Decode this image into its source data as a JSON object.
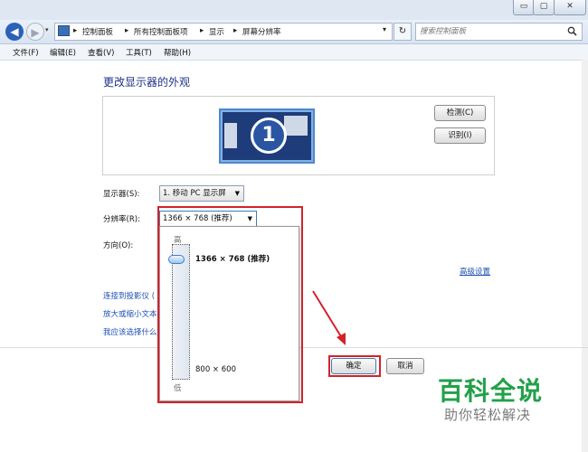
{
  "window": {
    "minimize_glyph": "▭",
    "maximize_glyph": "▢",
    "close_glyph": "✕"
  },
  "address": {
    "breadcrumb": [
      "控制面板",
      "所有控制面板项",
      "显示",
      "屏幕分辨率"
    ],
    "separator": "▸",
    "dropdown_glyph": "▾",
    "refresh_glyph": "↻",
    "search_placeholder": "搜索控制面板",
    "search_icon": "search-icon"
  },
  "menu": [
    "文件(F)",
    "编辑(E)",
    "查看(V)",
    "工具(T)",
    "帮助(H)"
  ],
  "main": {
    "heading": "更改显示器的外观",
    "monitor_number": "1",
    "detect_button": "检测(C)",
    "identify_button": "识别(I)",
    "display_label": "显示器(S):",
    "display_value": "1. 移动 PC 显示屏",
    "resolution_label": "分辨率(R):",
    "resolution_value": "1366 × 768 (推荐)",
    "orientation_label": "方向(O):",
    "advanced_link": "高级设置",
    "links": [
      "连接到投影仪 (",
      "放大或缩小文本",
      "我应该选择什么"
    ],
    "ok_button": "确定",
    "cancel_button": "取消"
  },
  "dropdown": {
    "high_label": "高",
    "low_label": "低",
    "max_resolution": "1366 × 768 (推荐)",
    "min_resolution": "800 × 600",
    "slider_level_fraction": 1.0
  },
  "watermark": {
    "title": "百科全说",
    "subtitle": "助你轻松解决",
    "color": "#23a04a"
  },
  "colors": {
    "highlight_red": "#d3222a",
    "link_blue": "#1e50b4",
    "heading_blue": "#1e3287"
  }
}
